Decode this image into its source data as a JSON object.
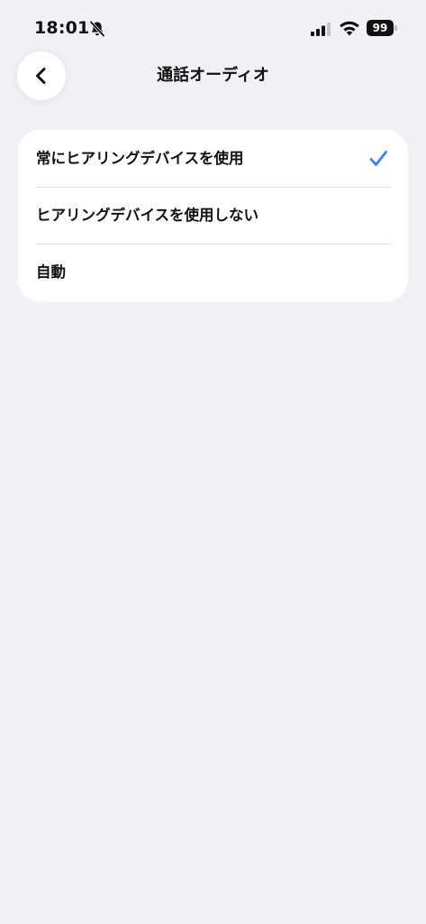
{
  "status_bar": {
    "time": "18:01",
    "battery_level": "99",
    "icons": [
      "bell-slash-icon",
      "cellular-signal-icon",
      "wifi-icon",
      "battery-icon"
    ]
  },
  "nav": {
    "back_icon": "chevron-left-icon",
    "title": "通話オーディオ"
  },
  "options": [
    {
      "label": "常にヒアリングデバイスを使用",
      "selected": true
    },
    {
      "label": "ヒアリングデバイスを使用しない",
      "selected": false
    },
    {
      "label": "自動",
      "selected": false
    }
  ],
  "colors": {
    "background": "#f0f0f5",
    "card": "#ffffff",
    "checkmark": "#3b82f6",
    "text": "#111111"
  }
}
